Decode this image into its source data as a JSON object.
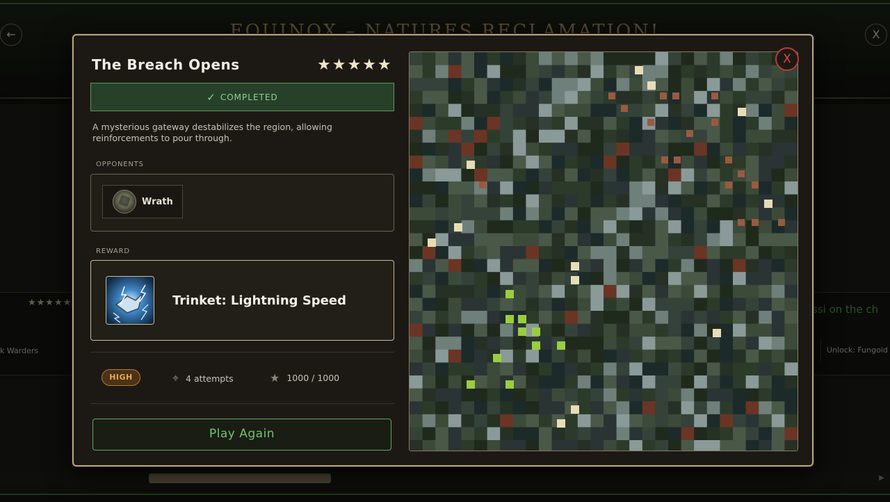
{
  "background": {
    "title": "EQUINOX – NATURES RECLAMATION!",
    "back_icon": "arrow-left-icon",
    "back_glyph": "←",
    "close_glyph": "X",
    "left_card": {
      "stars": "★★★★★",
      "text": "k Warders"
    },
    "right_card": {
      "title": "ssi on the ch",
      "unlock": "Unlock: Fungoid"
    }
  },
  "modal": {
    "title": "The Breach Opens",
    "stars": "★★★★★",
    "rating": 5,
    "status": "COMPLETED",
    "description": "A mysterious gateway destabilizes the region, allowing reinforcements to pour through.",
    "opponents_label": "OPPONENTS",
    "opponents": [
      {
        "name": "Wrath",
        "icon": "wrath-avatar-icon"
      }
    ],
    "reward_label": "REWARD",
    "reward": {
      "name": "Trinket: Lightning Speed",
      "icon": "lightning-trinket-icon"
    },
    "priority": "HIGH",
    "attempts": "4 attempts",
    "score": "1000 / 1000",
    "play_button": "Play Again",
    "close_label": "X",
    "colors": {
      "accent_gold": "#b8a47e",
      "success_green": "#74c36e",
      "danger_red": "#e04a40",
      "priority_orange": "#e8a850"
    }
  }
}
